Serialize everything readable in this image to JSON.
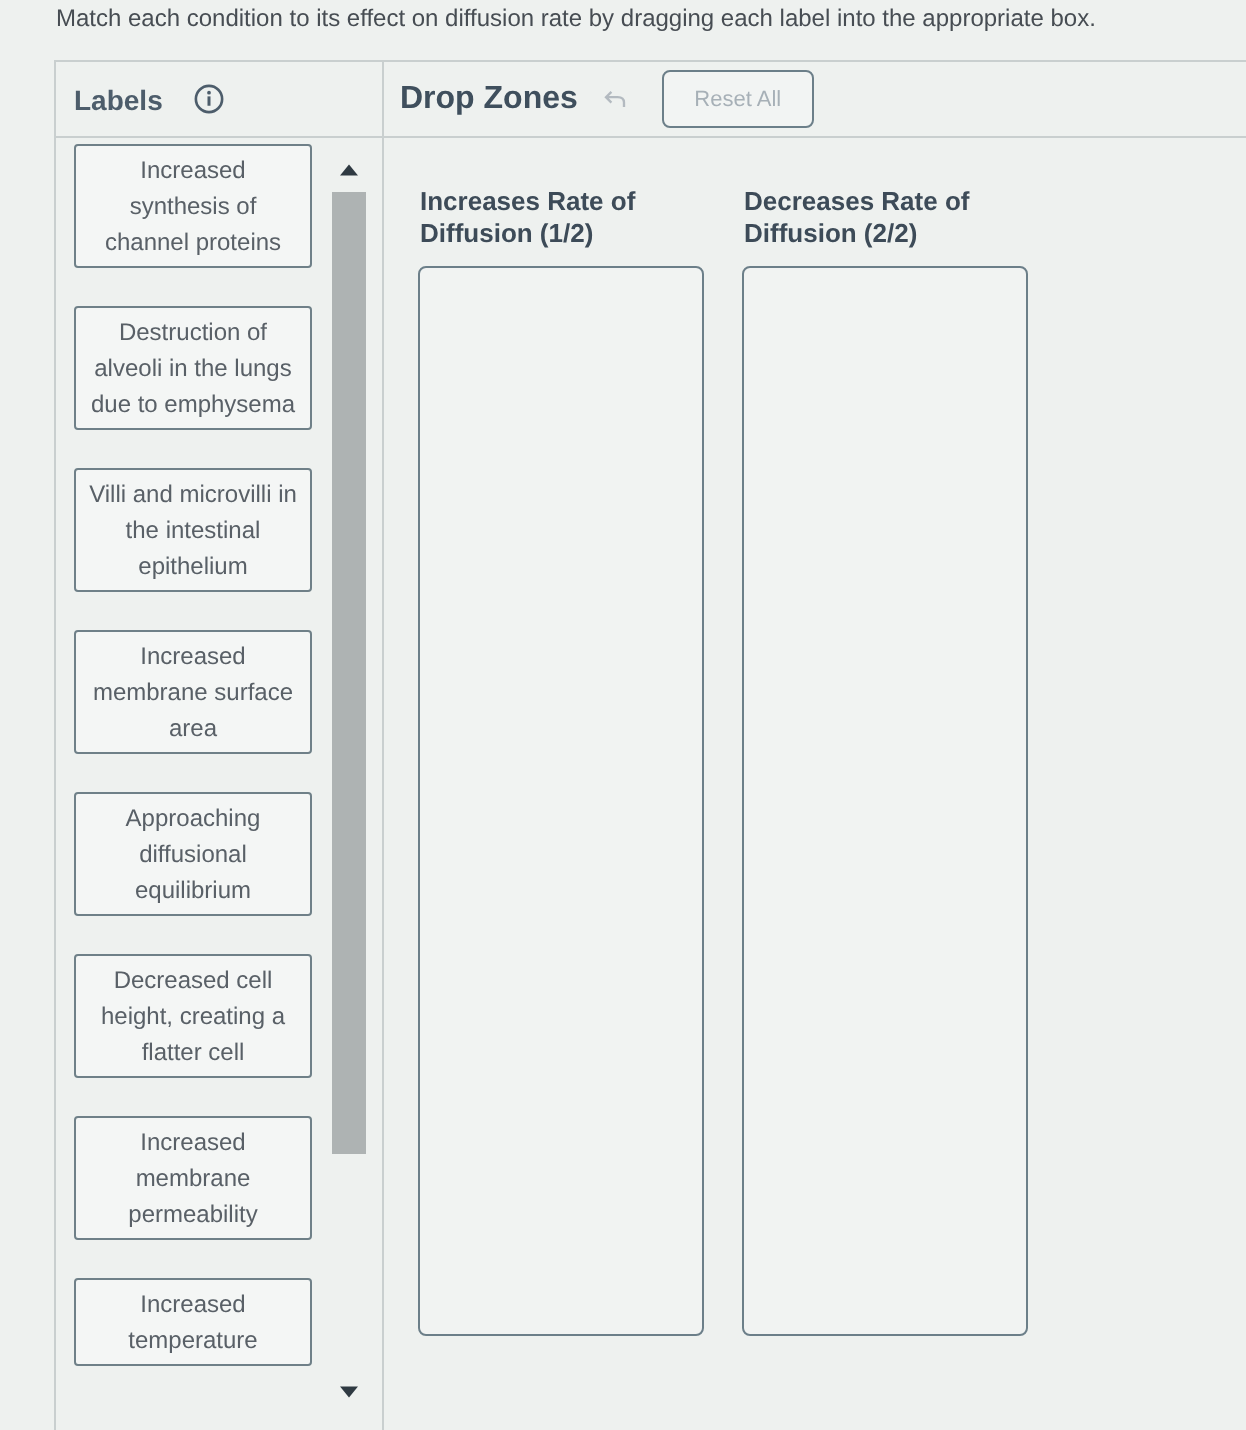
{
  "instruction": "Match each condition to its effect on diffusion rate by dragging each label into the appropriate box.",
  "labels_panel": {
    "title": "Labels",
    "cards": [
      "Increased synthesis of channel proteins",
      "Destruction of alveoli in the lungs due to emphysema",
      "Villi and microvilli in the intestinal epithelium",
      "Increased membrane surface area",
      "Approaching diffusional equilibrium",
      "Decreased cell height, creating a flatter cell",
      "Increased membrane permeability",
      "Increased temperature"
    ]
  },
  "drop_zones_panel": {
    "title": "Drop Zones",
    "undo_button": {
      "disabled": true
    },
    "reset_button": {
      "label": "Reset All",
      "disabled": true
    },
    "zones": [
      {
        "heading": "Increases Rate of Diffusion (1/2)"
      },
      {
        "heading": "Decreases Rate of Diffusion (2/2)"
      }
    ]
  }
}
